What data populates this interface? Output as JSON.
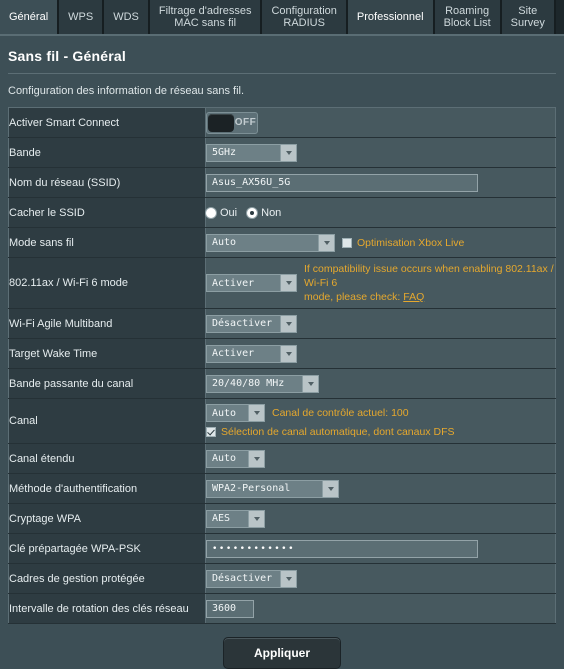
{
  "tabs": [
    {
      "label": "Général",
      "state": "active"
    },
    {
      "label": "WPS",
      "state": "normal"
    },
    {
      "label": "WDS",
      "state": "normal"
    },
    {
      "label": "Filtrage d'adresses\nMAC sans fil",
      "line1": "Filtrage d'adresses",
      "line2": "MAC sans fil",
      "state": "normal"
    },
    {
      "label": "Configuration\nRADIUS",
      "line1": "Configuration",
      "line2": "RADIUS",
      "state": "normal"
    },
    {
      "label": "Professionnel",
      "state": "hover"
    },
    {
      "label": "Roaming\nBlock List",
      "line1": "Roaming",
      "line2": "Block List",
      "state": "normal"
    },
    {
      "label": "Site\nSurvey",
      "line1": "Site",
      "line2": "Survey",
      "state": "normal"
    }
  ],
  "page": {
    "title": "Sans fil - Général",
    "description": "Configuration des information de réseau sans fil."
  },
  "rows": {
    "smart_connect": {
      "label": "Activer Smart Connect",
      "toggle_state": "OFF"
    },
    "band": {
      "label": "Bande",
      "value": "5GHz"
    },
    "ssid": {
      "label": "Nom du réseau (SSID)",
      "value": "Asus_AX56U_5G"
    },
    "hide_ssid": {
      "label": "Cacher le SSID",
      "option_yes": "Oui",
      "option_no": "Non",
      "selected": "Non"
    },
    "wireless_mode": {
      "label": "Mode sans fil",
      "value": "Auto",
      "checkbox_label": "Optimisation Xbox Live",
      "checkbox_checked": false
    },
    "wifi6_mode": {
      "label": "802.11ax / Wi-Fi 6 mode",
      "value": "Activer",
      "hint_line1": "If compatibility issue occurs when enabling 802.11ax / Wi-Fi 6",
      "hint_line2_pre": "mode, please check: ",
      "hint_link": "FAQ"
    },
    "agile_multiband": {
      "label": "Wi-Fi Agile Multiband",
      "value": "Désactiver"
    },
    "target_wake_time": {
      "label": "Target Wake Time",
      "value": "Activer"
    },
    "channel_bandwidth": {
      "label": "Bande passante du canal",
      "value": "20/40/80 MHz"
    },
    "channel": {
      "label": "Canal",
      "value": "Auto",
      "note": "Canal de contrôle actuel: 100",
      "checkbox_label": "Sélection de canal automatique, dont canaux DFS",
      "checkbox_checked": true
    },
    "extension_channel": {
      "label": "Canal étendu",
      "value": "Auto"
    },
    "auth_method": {
      "label": "Méthode d'authentification",
      "value": "WPA2-Personal"
    },
    "wpa_encryption": {
      "label": "Cryptage WPA",
      "value": "AES"
    },
    "wpa_psk": {
      "label": "Clé prépartagée WPA-PSK",
      "value": "••••••••••••"
    },
    "pmf": {
      "label": "Cadres de gestion protégée",
      "value": "Désactiver"
    },
    "rekey_interval": {
      "label": "Intervalle de rotation des clés réseau",
      "value": "3600"
    }
  },
  "footer": {
    "apply_label": "Appliquer"
  },
  "colors": {
    "accent_orange": "#e5a82e",
    "page_bg": "#3d4f56",
    "label_bg": "#2e3c42",
    "value_bg": "#47595f",
    "tab_bg": "#2c3a40"
  }
}
